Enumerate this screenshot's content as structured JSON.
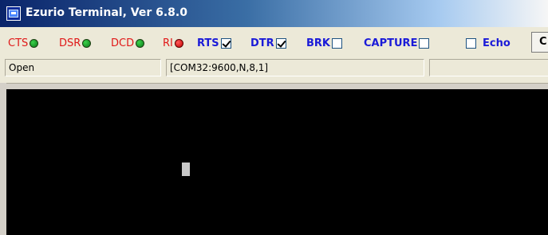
{
  "window": {
    "title": "Ezurio Terminal, Ver 6.8.0"
  },
  "signals": [
    {
      "label": "CTS",
      "led": "green"
    },
    {
      "label": "DSR",
      "led": "green"
    },
    {
      "label": "DCD",
      "led": "green"
    },
    {
      "label": "RI",
      "led": "red"
    }
  ],
  "toggles": {
    "rts": {
      "label": "RTS",
      "checked": true
    },
    "dtr": {
      "label": "DTR",
      "checked": true
    },
    "brk": {
      "label": "BRK",
      "checked": false
    },
    "capture": {
      "label": "CAPTURE",
      "checked": false
    },
    "echo": {
      "label": "Echo",
      "checked": false
    }
  },
  "toolbar": {
    "c_button_label": "C"
  },
  "status": {
    "state": "Open",
    "port_settings": "[COM32:9600,N,8,1]",
    "extra": ""
  },
  "colors": {
    "signal_label": "#e01818",
    "toggle_label": "#1a1ad8",
    "led_green": "#12a826",
    "led_red": "#e00000",
    "terminal_bg": "#000000",
    "cursor": "#c8c8c8"
  },
  "icons": [
    "terminal-app-icon",
    "led-indicator",
    "checkbox",
    "text-cursor"
  ]
}
